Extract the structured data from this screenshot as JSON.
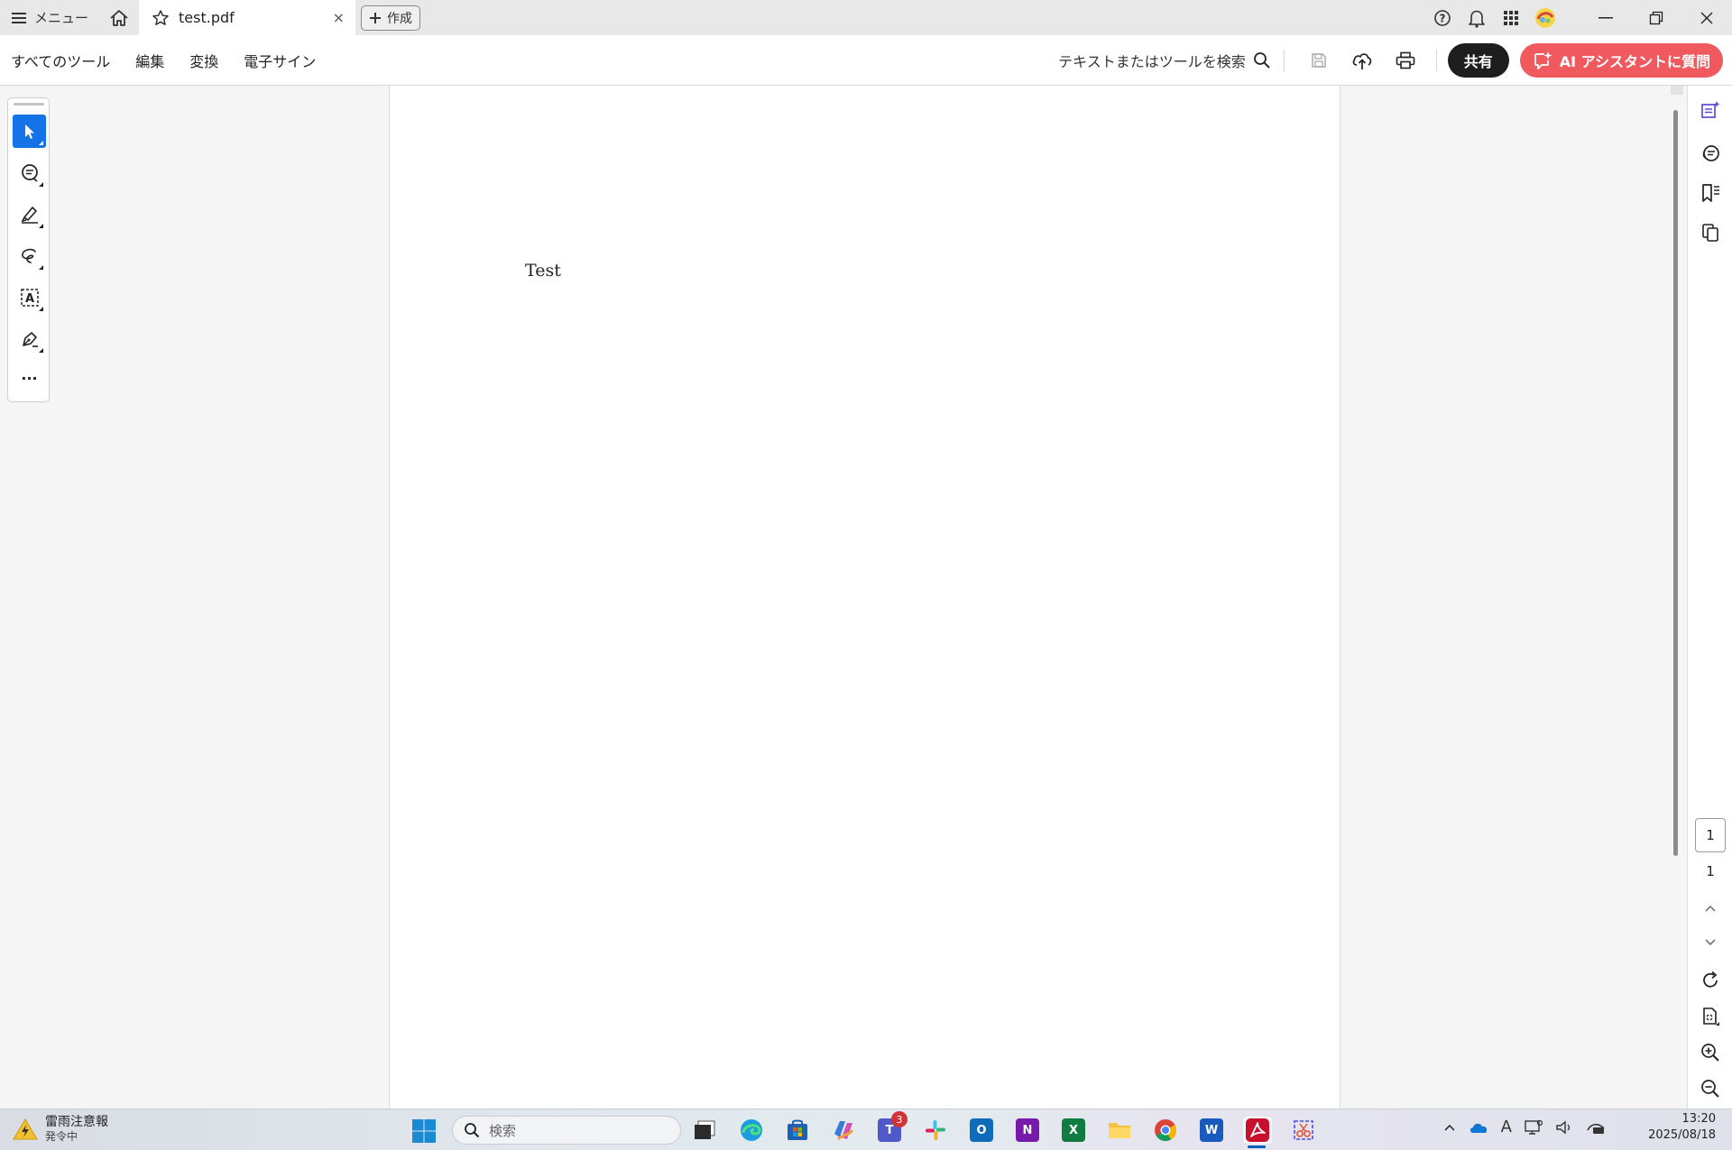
{
  "titlebar": {
    "menu_label": "メニュー",
    "tab_title": "test.pdf",
    "tab_close": "×",
    "create_label": "作成"
  },
  "toolbar": {
    "menu_items": [
      "すべてのツール",
      "編集",
      "変換",
      "電子サイン"
    ],
    "search_label": "テキストまたはツールを検索",
    "share_label": "共有",
    "ai_label": "AI アシスタントに質問"
  },
  "palette": {
    "more": "···"
  },
  "document": {
    "text": "Test"
  },
  "rail": {
    "current_page": "1",
    "total_pages": "1"
  },
  "taskbar": {
    "weather_title": "雷雨注意報",
    "weather_sub": "発令中",
    "search_placeholder": "検索",
    "teams_badge": "3",
    "time": "13:20",
    "date": "2025/08/18",
    "tray_ime": "A",
    "app_labels": {
      "teams": "T",
      "onenote": "N",
      "excel": "X",
      "word": "W",
      "outlook": "O"
    }
  },
  "colors": {
    "accent_blue": "#1473e6",
    "share_bg": "#1e1e1e",
    "ai_bg": "#f05a5e",
    "acrobat_red": "#c8102e"
  }
}
